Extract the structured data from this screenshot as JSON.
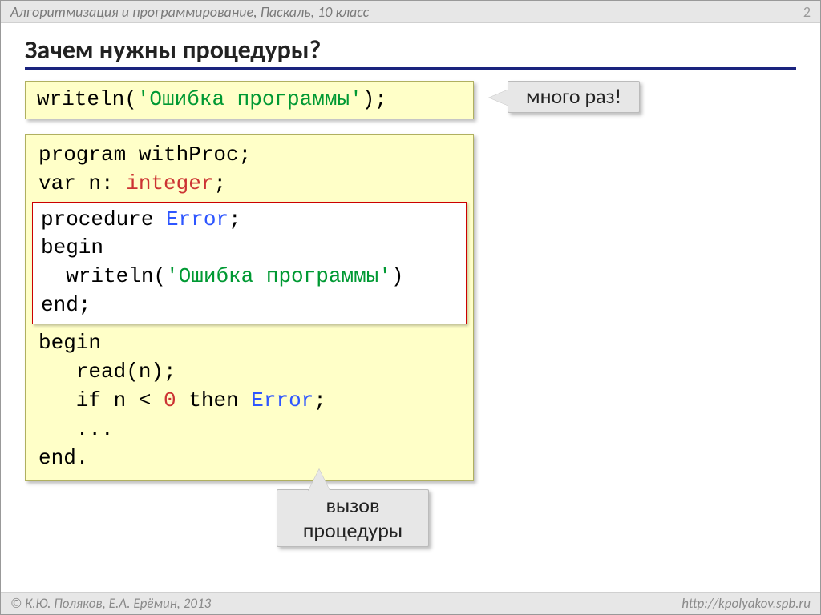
{
  "header": {
    "title": "Алгоритмизация и программирование, Паскаль, 10 класс",
    "page": "2"
  },
  "title": "Зачем нужны процедуры?",
  "snippet1": {
    "p1": "writeln(",
    "str": "'Ошибка программы'",
    "p2": ");"
  },
  "callout_many": "много раз!",
  "code": {
    "l1a": "program withProc;",
    "l2a": "var n: ",
    "l2b": "integer",
    "l2c": ";",
    "p1": "procedure ",
    "p1b": "Error",
    "p1c": ";",
    "p2": "begin",
    "p3a": "  writeln(",
    "p3str": "'Ошибка программы'",
    "p3b": ")",
    "p4": "end;",
    "b1": "begin",
    "b2": "   read(n);",
    "b3a": "   if n < ",
    "b3zero": "0",
    "b3b": " then ",
    "b3err": "Error",
    "b3c": ";",
    "b4": "   ...",
    "b5": "end."
  },
  "callout_call_l1": "вызов",
  "callout_call_l2": "процедуры",
  "footer": {
    "left": "© К.Ю. Поляков, Е.А. Ерёмин, 2013",
    "right": "http://kpolyakov.spb.ru"
  }
}
